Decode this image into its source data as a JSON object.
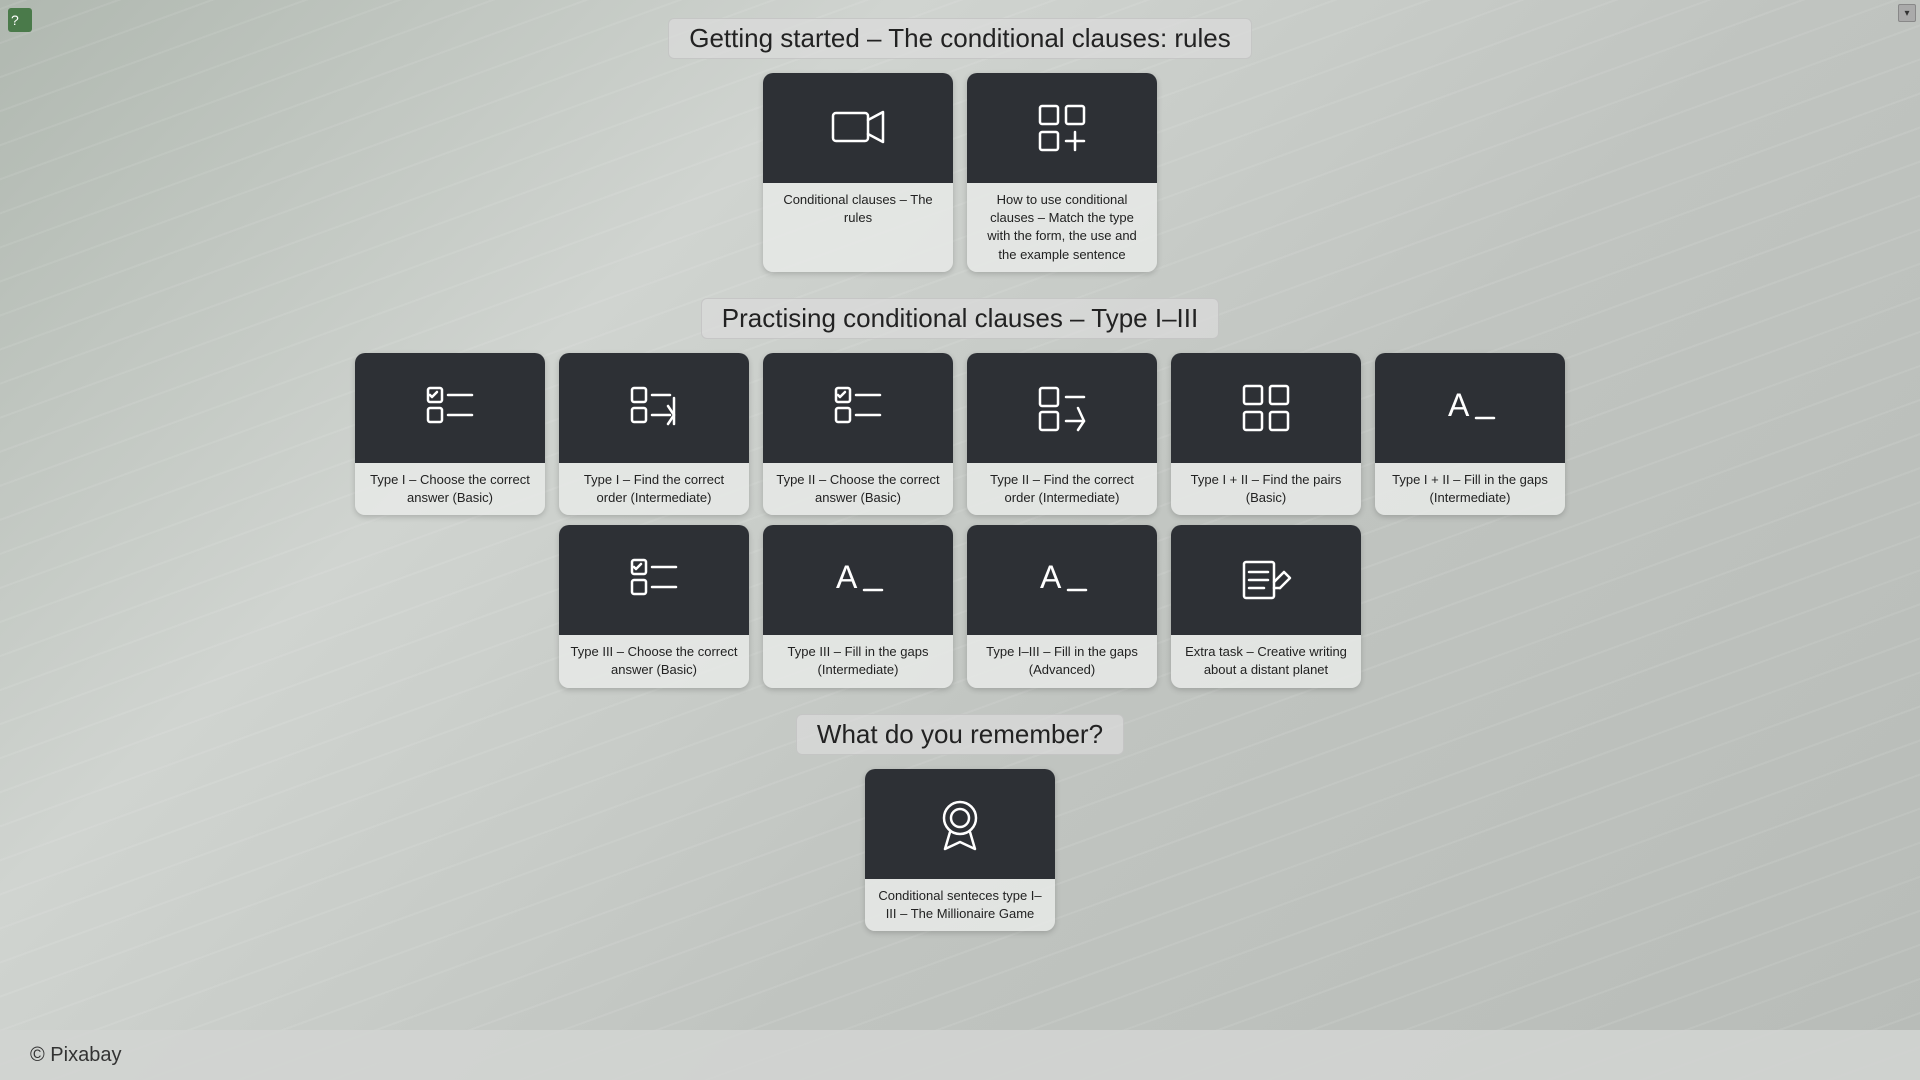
{
  "appIcon": "📖",
  "windowControls": {
    "minimize": "─",
    "maximize": "□",
    "close": "✕"
  },
  "sections": [
    {
      "id": "getting-started",
      "title": "Getting started – The conditional clauses: rules",
      "cards": [
        {
          "id": "conditional-rules",
          "label": "Conditional clauses – The rules",
          "icon": "video"
        },
        {
          "id": "how-to-use",
          "label": "How to use conditional clauses – Match the type with the form, the use and the example sentence",
          "icon": "grid-plus"
        }
      ]
    },
    {
      "id": "practising",
      "title": "Practising conditional clauses – Type I–III",
      "rows": [
        {
          "cards": [
            {
              "id": "type1-choose",
              "label": "Type I – Choose the correct answer (Basic)",
              "icon": "list-check"
            },
            {
              "id": "type1-order",
              "label": "Type I – Find the correct order (Intermediate)",
              "icon": "list-down"
            },
            {
              "id": "type2-choose",
              "label": "Type II – Choose the correct answer (Basic)",
              "icon": "list-check"
            },
            {
              "id": "type2-order",
              "label": "Type II – Find the correct order (Intermediate)",
              "icon": "grid-down"
            },
            {
              "id": "type12-pairs",
              "label": "Type I + II – Find the pairs (Basic)",
              "icon": "grid4"
            },
            {
              "id": "type12-fill",
              "label": "Type I + II – Fill in the gaps (Intermediate)",
              "icon": "fill-gaps"
            }
          ]
        },
        {
          "cards": [
            {
              "id": "type3-choose",
              "label": "Type III – Choose the correct answer (Basic)",
              "icon": "list-check"
            },
            {
              "id": "type3-fill",
              "label": "Type III – Fill in the gaps (Intermediate)",
              "icon": "fill-gaps"
            },
            {
              "id": "type123-fill",
              "label": "Type I–III – Fill in the gaps (Advanced)",
              "icon": "fill-gaps"
            },
            {
              "id": "extra-task",
              "label": "Extra task – Creative writing about a distant planet",
              "icon": "write"
            }
          ]
        }
      ]
    }
  ],
  "remember": {
    "title": "What do you remember?",
    "card": {
      "id": "millionaire",
      "label": "Conditional senteces type I–III – The Millionaire Game",
      "icon": "award"
    }
  },
  "footer": {
    "copyright": "© Pixabay"
  }
}
